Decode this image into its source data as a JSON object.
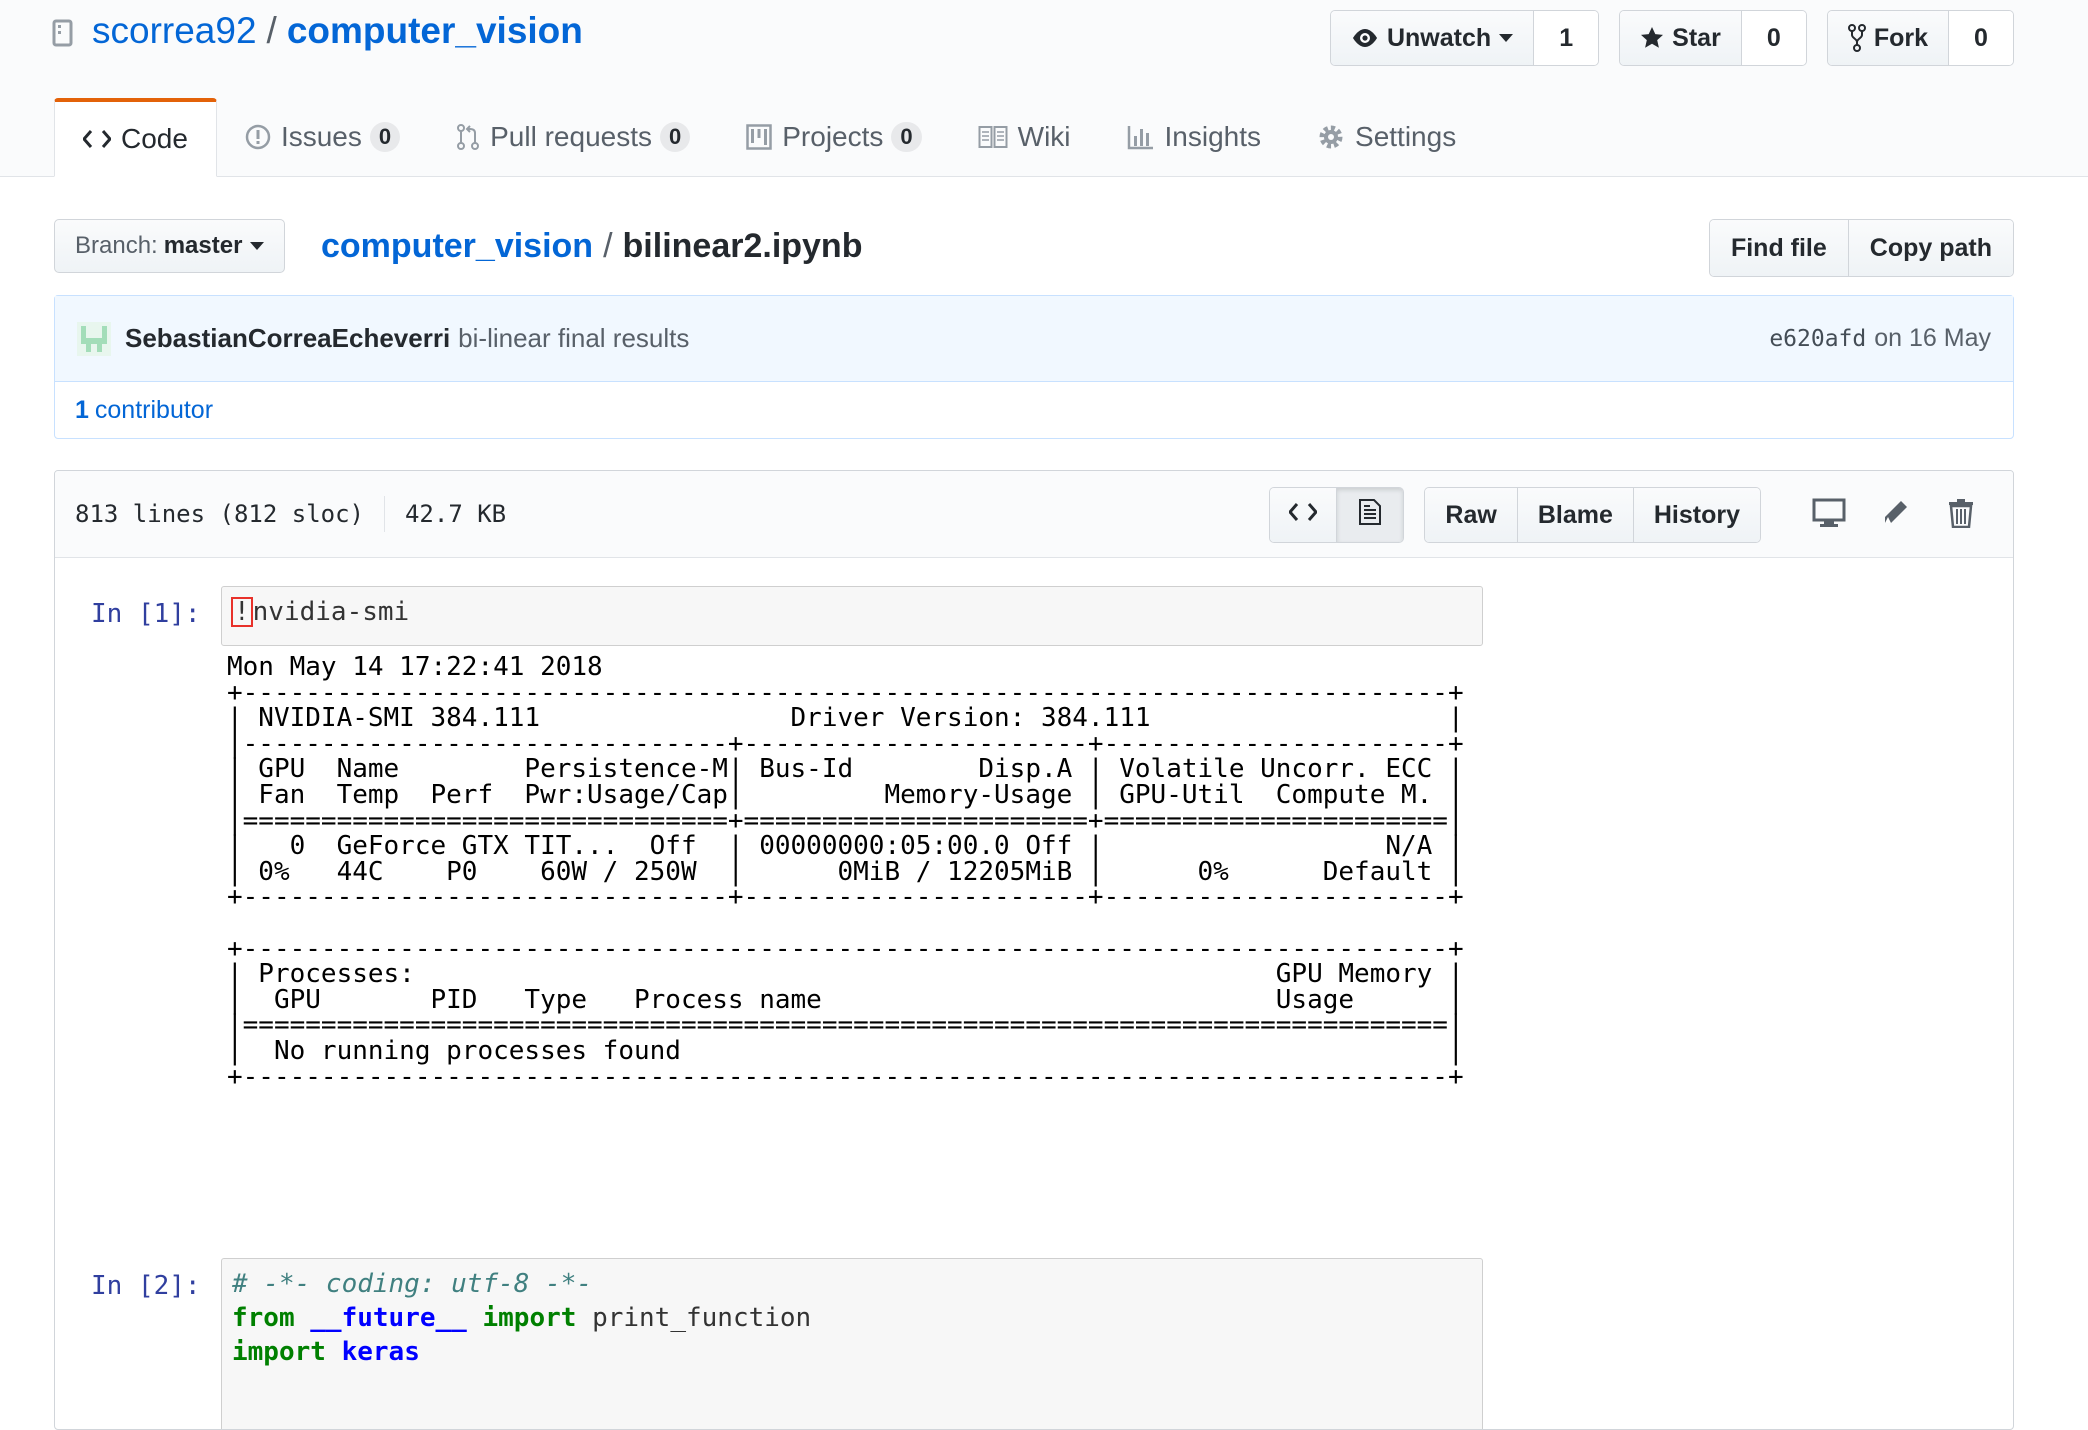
{
  "repo": {
    "owner": "scorrea92",
    "separator": "/",
    "name": "computer_vision"
  },
  "actions": {
    "watch_label": "Unwatch",
    "watch_count": "1",
    "star_label": "Star",
    "star_count": "0",
    "fork_label": "Fork",
    "fork_count": "0"
  },
  "nav": {
    "code": "Code",
    "issues": "Issues",
    "issues_count": "0",
    "pulls": "Pull requests",
    "pulls_count": "0",
    "projects": "Projects",
    "projects_count": "0",
    "wiki": "Wiki",
    "insights": "Insights",
    "settings": "Settings"
  },
  "branch": {
    "label": "Branch:",
    "value": "master"
  },
  "breadcrumb": {
    "repo": "computer_vision",
    "separator": "/",
    "file": "bilinear2.ipynb"
  },
  "file_nav": {
    "find_file": "Find file",
    "copy_path": "Copy path"
  },
  "commit": {
    "author": "SebastianCorreaEcheverri",
    "message": "bi-linear final results",
    "sha": "e620afd",
    "date": "on 16 May",
    "contributors_count": "1",
    "contributors_label": "contributor"
  },
  "file_info": {
    "lines": "813 lines (812 sloc)",
    "size": "42.7 KB"
  },
  "file_actions": {
    "raw": "Raw",
    "blame": "Blame",
    "history": "History"
  },
  "notebook": {
    "cell1": {
      "prompt": "In [1]:",
      "bang": "!",
      "code_rest": "nvidia-smi",
      "output": "Mon May 14 17:22:41 2018       \n+-----------------------------------------------------------------------------+\n| NVIDIA-SMI 384.111                Driver Version: 384.111                   |\n|-------------------------------+----------------------+----------------------+\n| GPU  Name        Persistence-M| Bus-Id        Disp.A | Volatile Uncorr. ECC |\n| Fan  Temp  Perf  Pwr:Usage/Cap|         Memory-Usage | GPU-Util  Compute M. |\n|===============================+======================+======================|\n|   0  GeForce GTX TIT...  Off  | 00000000:05:00.0 Off |                  N/A |\n| 0%   44C    P0    60W / 250W  |      0MiB / 12205MiB |      0%      Default |\n+-------------------------------+----------------------+----------------------+\n                                                                               \n+-----------------------------------------------------------------------------+\n| Processes:                                                       GPU Memory |\n|  GPU       PID   Type   Process name                             Usage      |\n|=============================================================================|\n|  No running processes found                                                 |\n+-----------------------------------------------------------------------------+"
    },
    "cell2": {
      "prompt": "In [2]:",
      "line1_comment": "# -*- coding: utf-8 -*-",
      "line2_from": "from",
      "line2_module": "__future__",
      "line2_import": "import",
      "line2_name": "print_function",
      "line3_import": "import",
      "line3_module": "keras"
    }
  },
  "colors": {
    "link": "#0366d6",
    "tab_accent": "#e36209",
    "prompt": "#303f9f",
    "highlight_box": "#e8312a"
  }
}
